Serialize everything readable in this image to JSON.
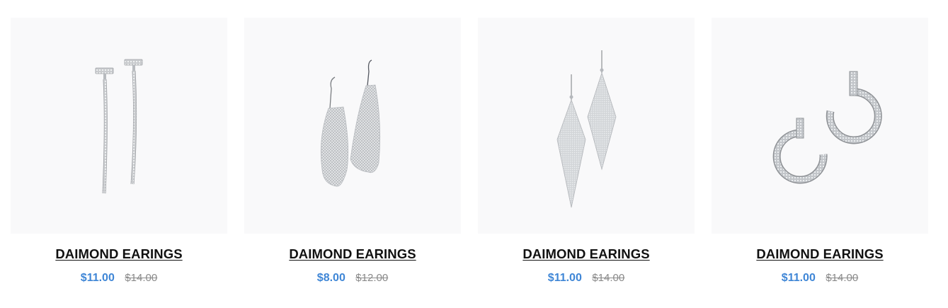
{
  "products": [
    {
      "title": "DAIMOND EARINGS",
      "price": "$11.00",
      "old_price": "$14.00",
      "image_icon": "bar-drop-earrings"
    },
    {
      "title": "DAIMOND EARINGS",
      "price": "$8.00",
      "old_price": "$12.00",
      "image_icon": "mesh-scarf-earrings"
    },
    {
      "title": "DAIMOND EARINGS",
      "price": "$11.00",
      "old_price": "$14.00",
      "image_icon": "diamond-mesh-earrings"
    },
    {
      "title": "DAIMOND EARINGS",
      "price": "$11.00",
      "old_price": "$14.00",
      "image_icon": "t-hoop-earrings"
    }
  ],
  "colors": {
    "sale": "#3f86d6",
    "old": "#8a8a8a",
    "title": "#111111",
    "thumb_bg": "#f9f9fa"
  }
}
